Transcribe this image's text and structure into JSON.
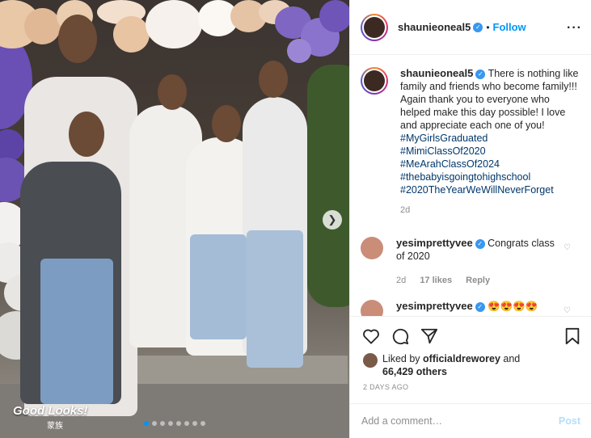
{
  "photo": {
    "alt": "Family photo with balloon arch",
    "watermark": "Good Looks!",
    "watermark_sub": "蒙族",
    "next_icon": "chevron-right-icon",
    "slides": 8,
    "active_slide": 1
  },
  "header": {
    "username": "shaunieoneal5",
    "follow_label": "Follow",
    "separator": "•"
  },
  "caption": {
    "username": "shaunieoneal5",
    "text": "There is nothing like family and friends who become family!!! Again thank you to everyone who helped make this day possible! I love and appreciate each one of you!",
    "hashtags": [
      "#MyGirlsGraduated",
      "#MimiClassOf2020",
      "#MeArahClassOf2024",
      "#thebabyisgoingtohighschool",
      "#2020TheYearWeWillNeverForget"
    ],
    "age": "2d"
  },
  "comments": [
    {
      "username": "yesimprettyvee",
      "text": "Congrats class of 2020",
      "age": "2d",
      "likes": "17 likes",
      "reply": "Reply"
    },
    {
      "username": "yesimprettyvee",
      "text": "😍😍😍😍"
    }
  ],
  "likes": {
    "prefix": "Liked by",
    "user": "officialdreworey",
    "conj": "and",
    "count": "66,429 others"
  },
  "date": "2 DAYS AGO",
  "add_comment": {
    "placeholder": "Add a comment…",
    "post_label": "Post"
  },
  "colors": {
    "accent": "#0095f6",
    "hashtag": "#00376b",
    "muted": "#8e8e8e",
    "verified": "#3897f0"
  }
}
